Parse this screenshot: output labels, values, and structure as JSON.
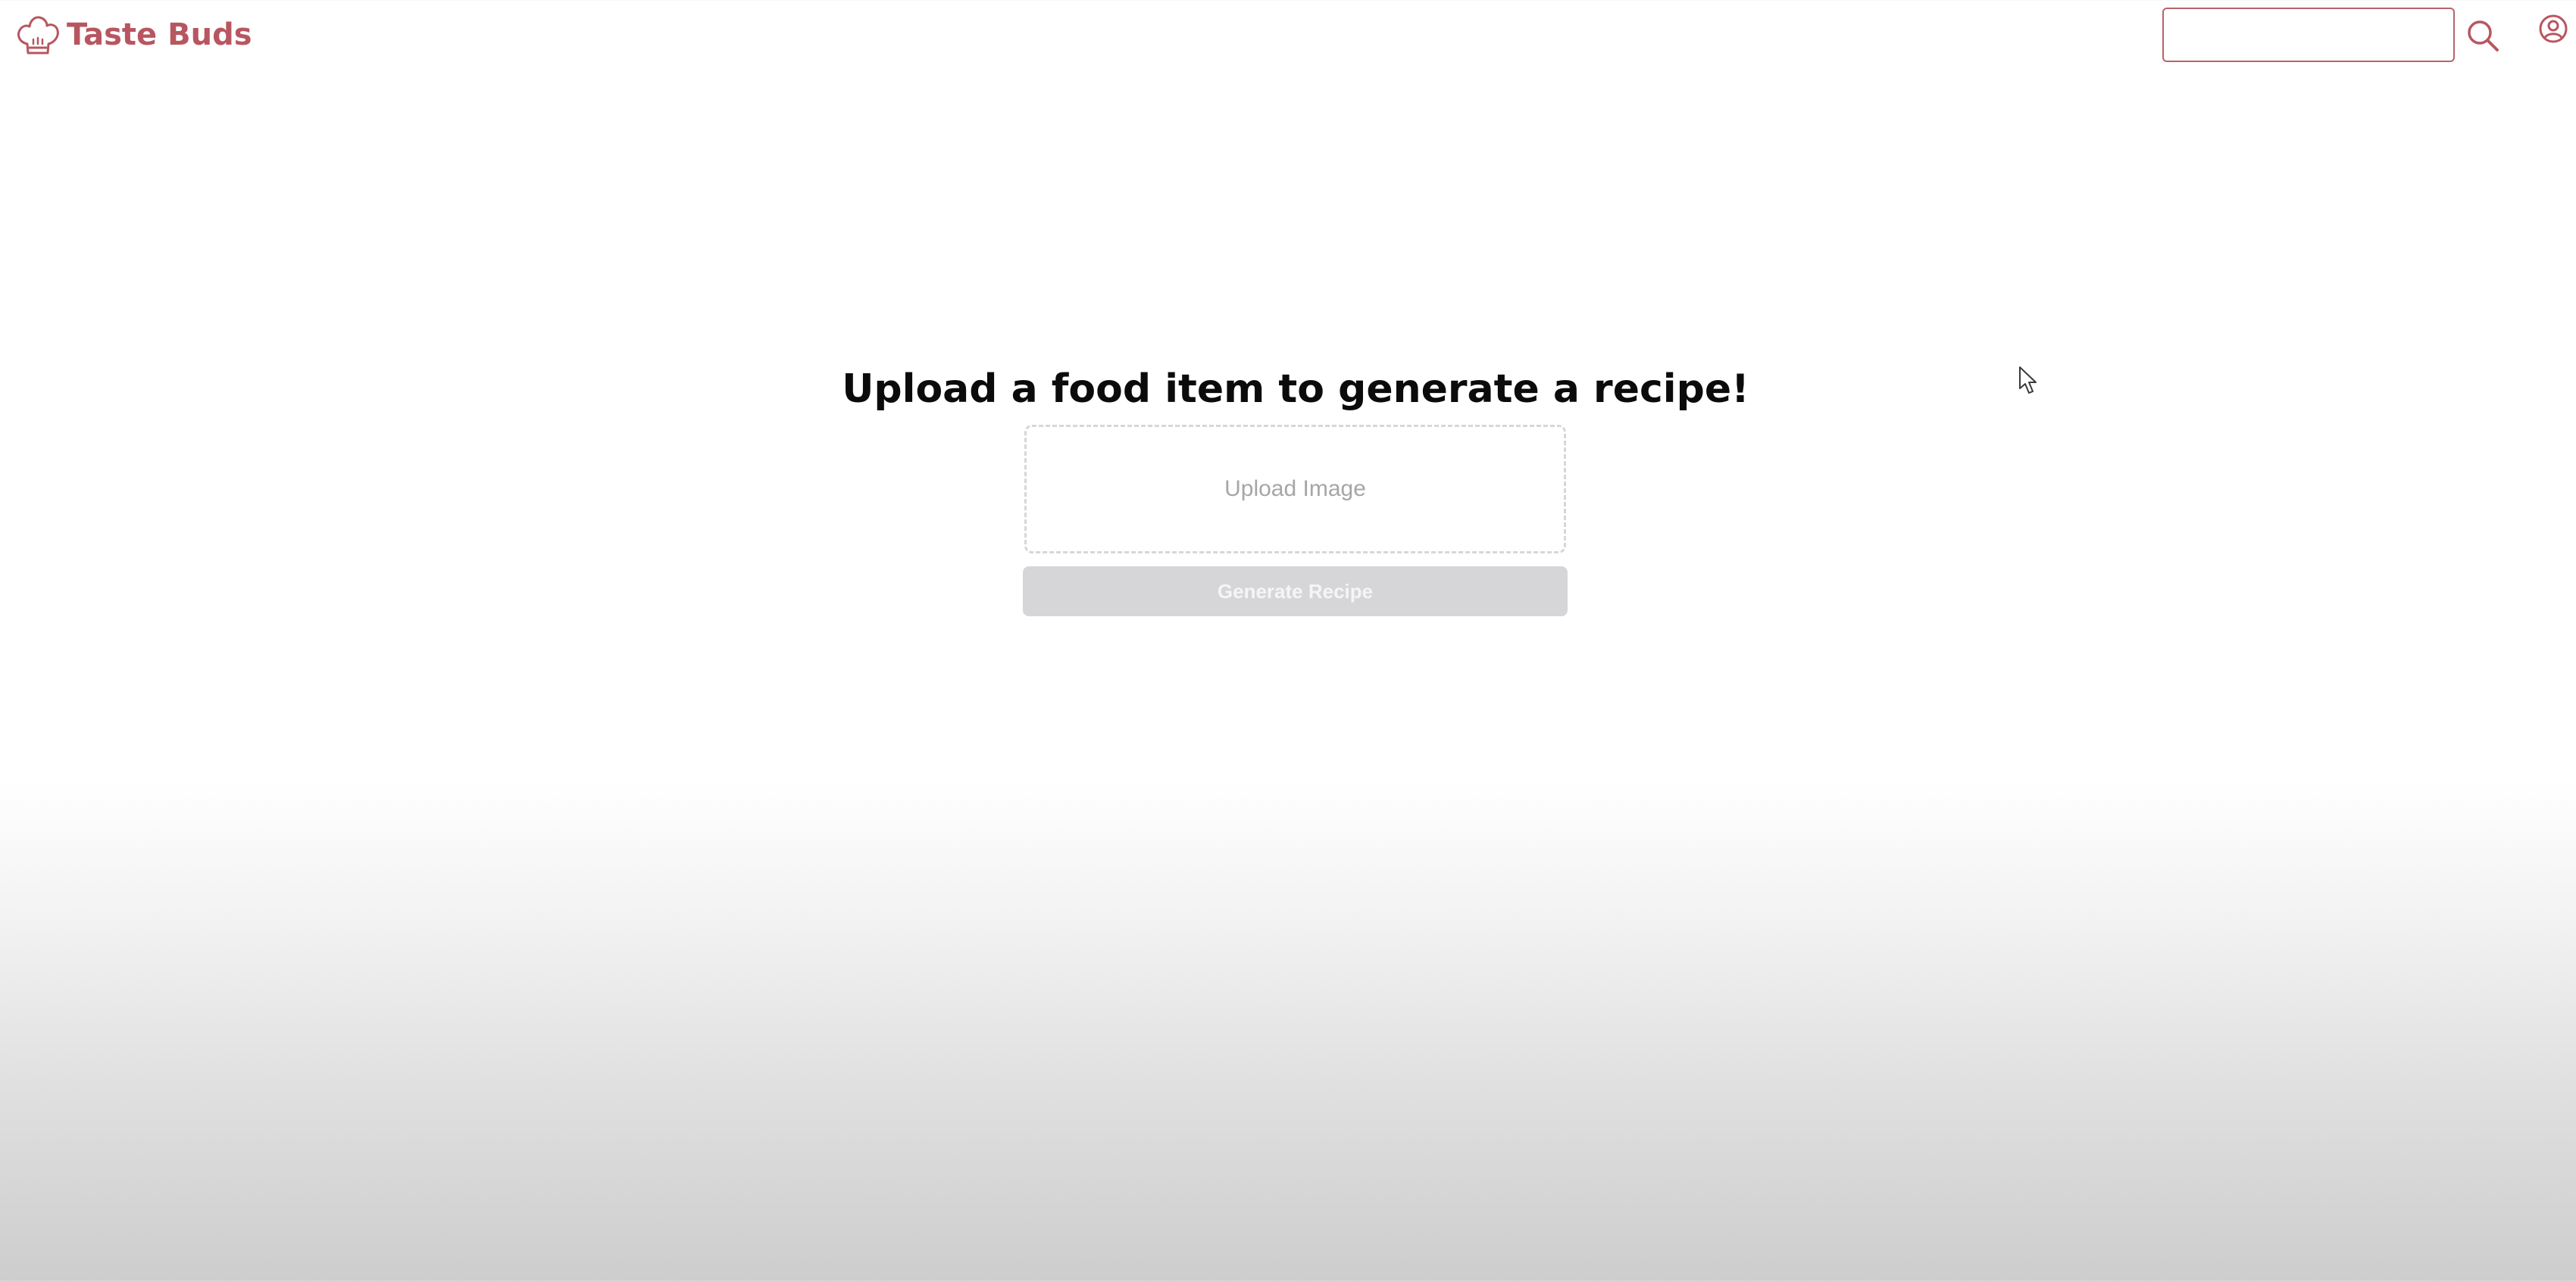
{
  "header": {
    "brand_name": "Taste Buds",
    "brand_icon": "chef-hat-icon",
    "search": {
      "value": "",
      "placeholder": "",
      "icon": "search-icon"
    },
    "profile_icon": "user-circle-icon"
  },
  "main": {
    "title": "Upload a food item to generate a recipe!",
    "upload_label": "Upload Image",
    "generate_button_label": "Generate Recipe",
    "generate_button_state": "disabled"
  },
  "colors": {
    "brand": "#b85660",
    "search_border": "#b8636a",
    "title": "#0b0b0b",
    "upload_border": "#d7d7d7",
    "upload_text": "#a6a6a6",
    "button_disabled_bg": "#d6d6d8",
    "button_disabled_text": "#f5f5f5",
    "background_top": "#ffffff",
    "background_bottom": "#cdcdcd"
  }
}
